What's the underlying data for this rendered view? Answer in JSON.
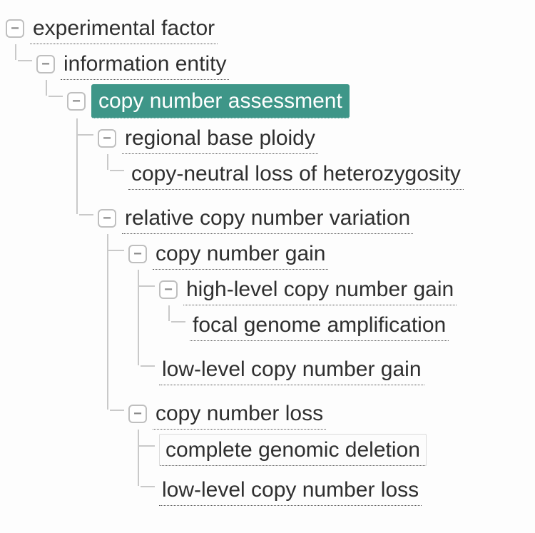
{
  "tree": {
    "label": "experimental factor",
    "expanded": true,
    "selected": false,
    "children": [
      {
        "label": "information entity",
        "expanded": true,
        "selected": false,
        "children": [
          {
            "label": "copy number assessment",
            "expanded": true,
            "selected": true,
            "children": [
              {
                "label": "regional base ploidy",
                "expanded": true,
                "selected": false,
                "children": [
                  {
                    "label": "copy-neutral loss of heterozygosity",
                    "expanded": false,
                    "selected": false,
                    "children": []
                  }
                ]
              },
              {
                "label": "relative copy number variation",
                "expanded": true,
                "selected": false,
                "children": [
                  {
                    "label": "copy number gain",
                    "expanded": true,
                    "selected": false,
                    "children": [
                      {
                        "label": "high-level copy number gain",
                        "expanded": true,
                        "selected": false,
                        "children": [
                          {
                            "label": "focal genome amplification",
                            "expanded": false,
                            "selected": false,
                            "children": []
                          }
                        ]
                      },
                      {
                        "label": "low-level copy number gain",
                        "expanded": false,
                        "selected": false,
                        "children": []
                      }
                    ]
                  },
                  {
                    "label": "copy number loss",
                    "expanded": true,
                    "selected": false,
                    "children": [
                      {
                        "label": "complete genomic deletion",
                        "expanded": false,
                        "selected": false,
                        "hover": true,
                        "children": []
                      },
                      {
                        "label": "low-level copy number loss",
                        "expanded": false,
                        "selected": false,
                        "children": []
                      }
                    ]
                  }
                ]
              }
            ]
          }
        ]
      }
    ]
  },
  "toggle_glyph": {
    "expanded": "−",
    "collapsed": "+"
  }
}
